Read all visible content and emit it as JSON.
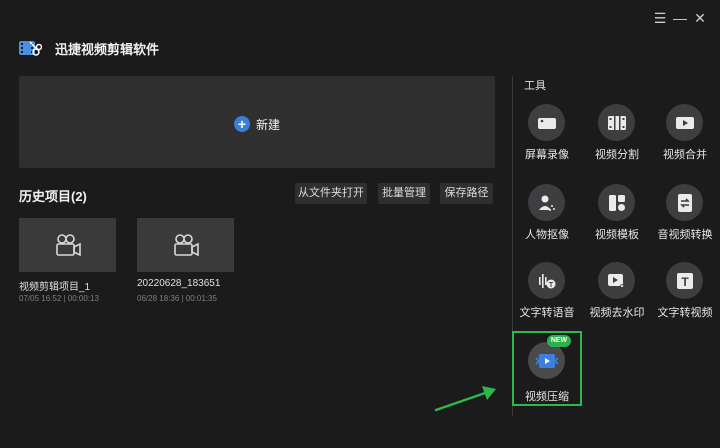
{
  "app": {
    "title": "迅捷视频剪辑软件"
  },
  "window_controls": {
    "menu": "☰",
    "minimize": "—",
    "close": "✕"
  },
  "new_project": {
    "label": "新建"
  },
  "history": {
    "title": "历史项目(2)",
    "buttons": {
      "open_folder": "从文件夹打开",
      "batch_manage": "批量管理",
      "save_path": "保存路径"
    },
    "projects": [
      {
        "name": "视频剪辑项目_1",
        "meta": "07/05 16:52 | 00:00:13"
      },
      {
        "name": "20220628_183651",
        "meta": "06/28 18:36 | 00:01:35"
      }
    ]
  },
  "tools": {
    "title": "工具",
    "items": [
      {
        "label": "屏幕录像",
        "icon": "camera-icon"
      },
      {
        "label": "视频分割",
        "icon": "film-split-icon"
      },
      {
        "label": "视频合并",
        "icon": "video-play-icon"
      },
      {
        "label": "人物抠像",
        "icon": "person-cutout-icon"
      },
      {
        "label": "视频模板",
        "icon": "template-icon"
      },
      {
        "label": "音视频转换",
        "icon": "convert-icon"
      },
      {
        "label": "文字转语音",
        "icon": "text-to-speech-icon"
      },
      {
        "label": "视频去水印",
        "icon": "watermark-remove-icon"
      },
      {
        "label": "文字转视频",
        "icon": "text-to-video-icon"
      },
      {
        "label": "视频压缩",
        "icon": "video-compress-icon",
        "badge": "NEW"
      }
    ]
  },
  "colors": {
    "accent": "#3a7ddb",
    "highlight": "#2cb84a",
    "background": "#1b1b1c"
  }
}
